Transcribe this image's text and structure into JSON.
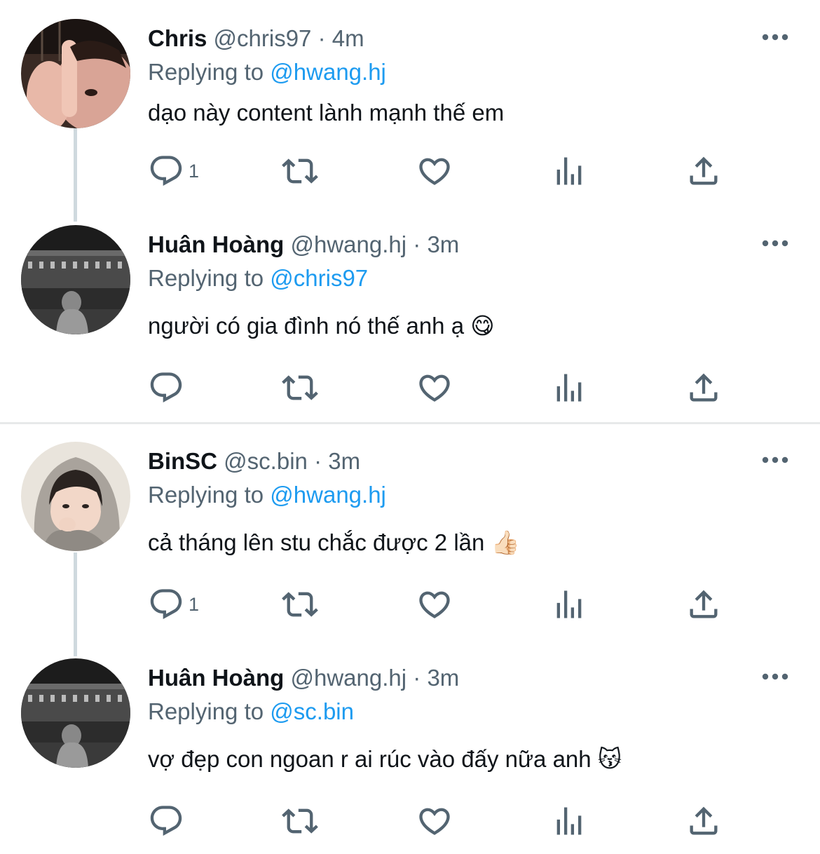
{
  "colors": {
    "text_primary": "#0f1419",
    "text_secondary": "#536471",
    "link": "#1d9bf0",
    "thread_line": "#cfd9de",
    "divider": "#e7e9ea"
  },
  "icons": [
    "reply-icon",
    "retweet-icon",
    "like-icon",
    "analytics-icon",
    "share-icon",
    "more-icon"
  ],
  "tweets": [
    {
      "name": "Chris",
      "handle": "@chris97",
      "time": "· 4m",
      "replying_label": "Replying to",
      "replying_to": "@hwang.hj",
      "text": "dạo này content lành mạnh thế em",
      "reply_count": "1"
    },
    {
      "name": "Huân Hoàng",
      "handle": "@hwang.hj",
      "time": "· 3m",
      "replying_label": "Replying to",
      "replying_to": "@chris97",
      "text": "người có gia đình nó thế anh ạ 😋",
      "reply_count": ""
    },
    {
      "name": "BinSC",
      "handle": "@sc.bin",
      "time": "· 3m",
      "replying_label": "Replying to",
      "replying_to": "@hwang.hj",
      "text": "cả tháng lên stu chắc được 2 lần 👍🏻",
      "reply_count": "1"
    },
    {
      "name": "Huân Hoàng",
      "handle": "@hwang.hj",
      "time": "· 3m",
      "replying_label": "Replying to",
      "replying_to": "@sc.bin",
      "text": "vợ đẹp con ngoan r ai rúc vào đấy nữa anh 😽",
      "reply_count": ""
    }
  ]
}
